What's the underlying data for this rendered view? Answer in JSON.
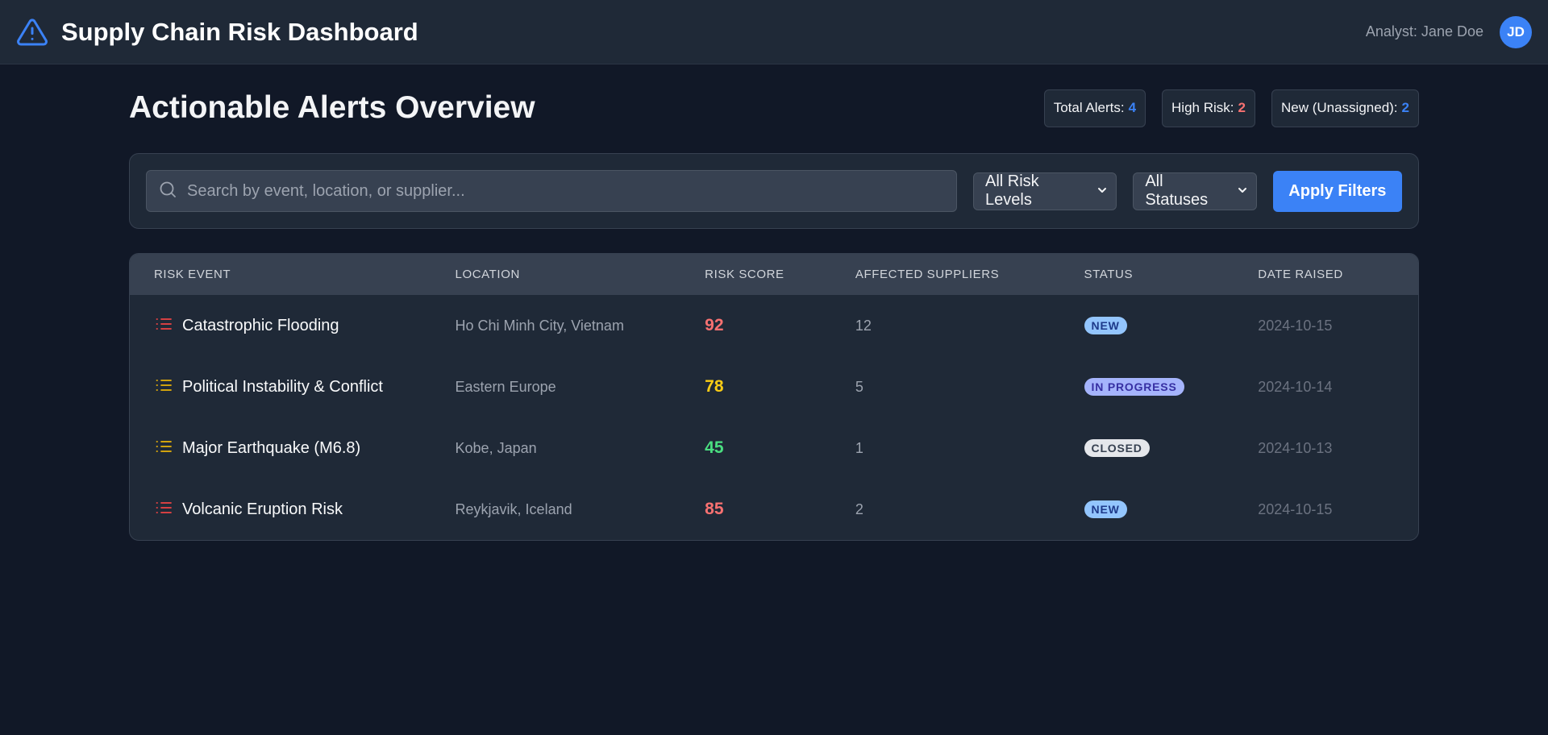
{
  "app": {
    "title": "Supply Chain Risk Dashboard",
    "logo_icon": "warning-triangle-icon",
    "analyst_label": "Analyst: Jane Doe",
    "avatar_initials": "JD"
  },
  "page": {
    "title": "Actionable Alerts Overview"
  },
  "stats": [
    {
      "label": "Total Alerts:",
      "value": "4",
      "color": "#3b82f6"
    },
    {
      "label": "High Risk:",
      "value": "2",
      "color": "#f87171"
    },
    {
      "label": "New (Unassigned):",
      "value": "2",
      "color": "#3b82f6"
    }
  ],
  "filters": {
    "search_placeholder": "Search by event, location, or supplier...",
    "search_value": "",
    "search_icon": "search-icon",
    "risk_level_selected": "All Risk Levels",
    "status_selected": "All Statuses",
    "apply_label": "Apply Filters"
  },
  "table": {
    "columns": [
      "RISK EVENT",
      "LOCATION",
      "RISK SCORE",
      "AFFECTED SUPPLIERS",
      "STATUS",
      "DATE RAISED"
    ],
    "rows": [
      {
        "event": "Catastrophic Flooding",
        "location": "Ho Chi Minh City, Vietnam",
        "score": "92",
        "suppliers": "12",
        "status": "NEW",
        "date": "2024-10-15",
        "icon": "list-icon",
        "icon_color": "#ef4444",
        "score_color": "red",
        "status_type": "new"
      },
      {
        "event": "Political Instability & Conflict",
        "location": "Eastern Europe",
        "score": "78",
        "suppliers": "5",
        "status": "IN PROGRESS",
        "date": "2024-10-14",
        "icon": "list-icon",
        "icon_color": "#eab308",
        "score_color": "yellow",
        "status_type": "progress"
      },
      {
        "event": "Major Earthquake (M6.8)",
        "location": "Kobe, Japan",
        "score": "45",
        "suppliers": "1",
        "status": "CLOSED",
        "date": "2024-10-13",
        "icon": "list-icon",
        "icon_color": "#eab308",
        "score_color": "green",
        "status_type": "closed"
      },
      {
        "event": "Volcanic Eruption Risk",
        "location": "Reykjavik, Iceland",
        "score": "85",
        "suppliers": "2",
        "status": "NEW",
        "date": "2024-10-15",
        "icon": "list-icon",
        "icon_color": "#ef4444",
        "score_color": "red",
        "status_type": "new"
      }
    ]
  },
  "colors": {
    "accent": "#3b82f6",
    "background": "#111827",
    "panel": "#1f2937"
  }
}
